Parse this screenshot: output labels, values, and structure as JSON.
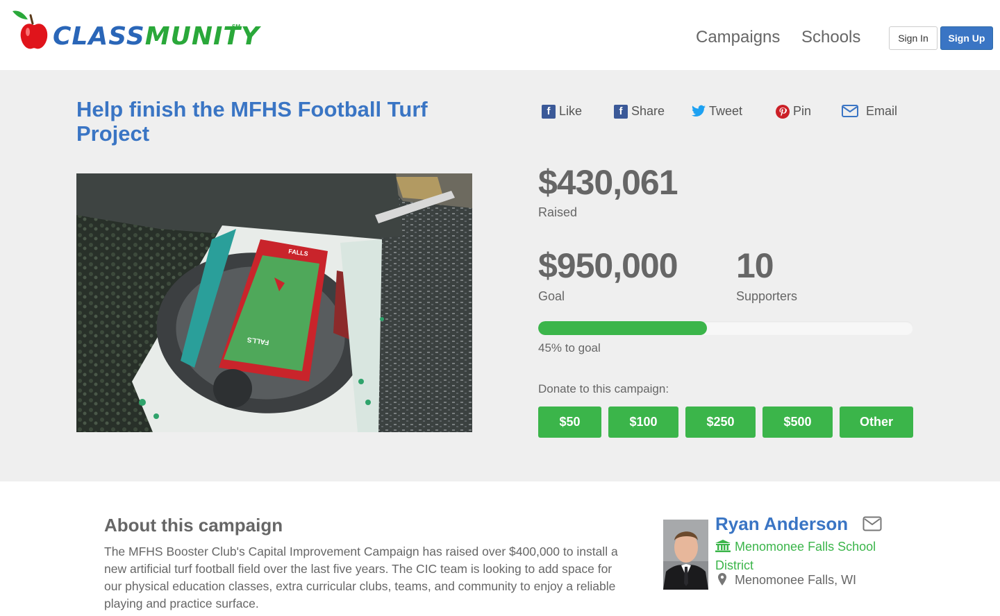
{
  "header": {
    "logo_text_part1": "CLASS",
    "logo_text_part2": "MUNITY",
    "logo_mark": "SM",
    "nav": {
      "campaigns": "Campaigns",
      "schools": "Schools"
    },
    "sign_in": "Sign In",
    "sign_up": "Sign Up"
  },
  "campaign": {
    "title": "Help finish the MFHS Football Turf Project",
    "stadium_end_zone_text": "FALLS",
    "share": {
      "like": "Like",
      "share": "Share",
      "tweet": "Tweet",
      "pin": "Pin",
      "email": "Email"
    },
    "raised_amount": "$430,061",
    "raised_label": "Raised",
    "goal_amount": "$950,000",
    "goal_label": "Goal",
    "supporters_count": "10",
    "supporters_label": "Supporters",
    "progress_percent": 45,
    "progress_text": "45% to goal",
    "donate_label": "Donate to this campaign:",
    "donate_options": [
      "$50",
      "$100",
      "$250",
      "$500",
      "Other"
    ]
  },
  "about": {
    "title": "About this campaign",
    "text": "The MFHS Booster Club's Capital Improvement Campaign has raised over $400,000 to install a new artificial turf football field over the last five years. The CIC team is looking to add space for our physical education classes, extra curricular clubs, teams, and community to enjoy a reliable playing and practice surface."
  },
  "owner": {
    "name": "Ryan Anderson",
    "district": "Menomonee Falls School District",
    "location": "Menomonee Falls, WI"
  },
  "colors": {
    "brand_blue": "#3a75c4",
    "brand_green": "#3bb54a",
    "hero_bg": "#efefef"
  },
  "icons": {
    "logo": "apple-icon",
    "like": "facebook-icon",
    "share": "facebook-icon",
    "tweet": "twitter-icon",
    "pin": "pinterest-icon",
    "email": "envelope-icon",
    "district": "bank-icon",
    "location": "map-pin-icon"
  }
}
